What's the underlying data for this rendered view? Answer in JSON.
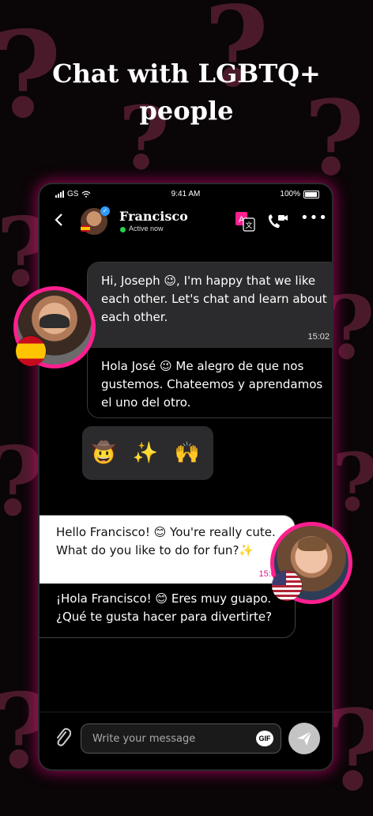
{
  "headline": {
    "line1": "Chat with LGBTQ+",
    "line2": "people"
  },
  "status_bar": {
    "carrier": "GS",
    "time": "9:41 AM",
    "battery": "100%"
  },
  "chat_header": {
    "contact_name": "Francisco",
    "status": "Active now"
  },
  "messages": [
    {
      "original": "Hi, Joseph 😉, I'm happy that we like each other.  Let's chat and learn about each other.",
      "time": "15:02",
      "translation": "Hola José 😉 Me alegro de que nos gustemos.  Chateemos  y aprendamos el uno del otro."
    },
    {
      "emoji": "🤠 ✨ 🙌"
    },
    {
      "original": "Hello Francisco! 😊 You're really cute. What do you like to do for fun?✨",
      "time": "15:03",
      "translation": "¡Hola Francisco! 😊 Eres muy guapo. ¿Qué te gusta hacer para divertirte?"
    }
  ],
  "composer": {
    "placeholder": "Write your message",
    "gif_label": "GIF"
  },
  "colors": {
    "accent": "#ff1f8f",
    "bubble_dark": "#2b2b2d",
    "background": "#0a0507"
  }
}
